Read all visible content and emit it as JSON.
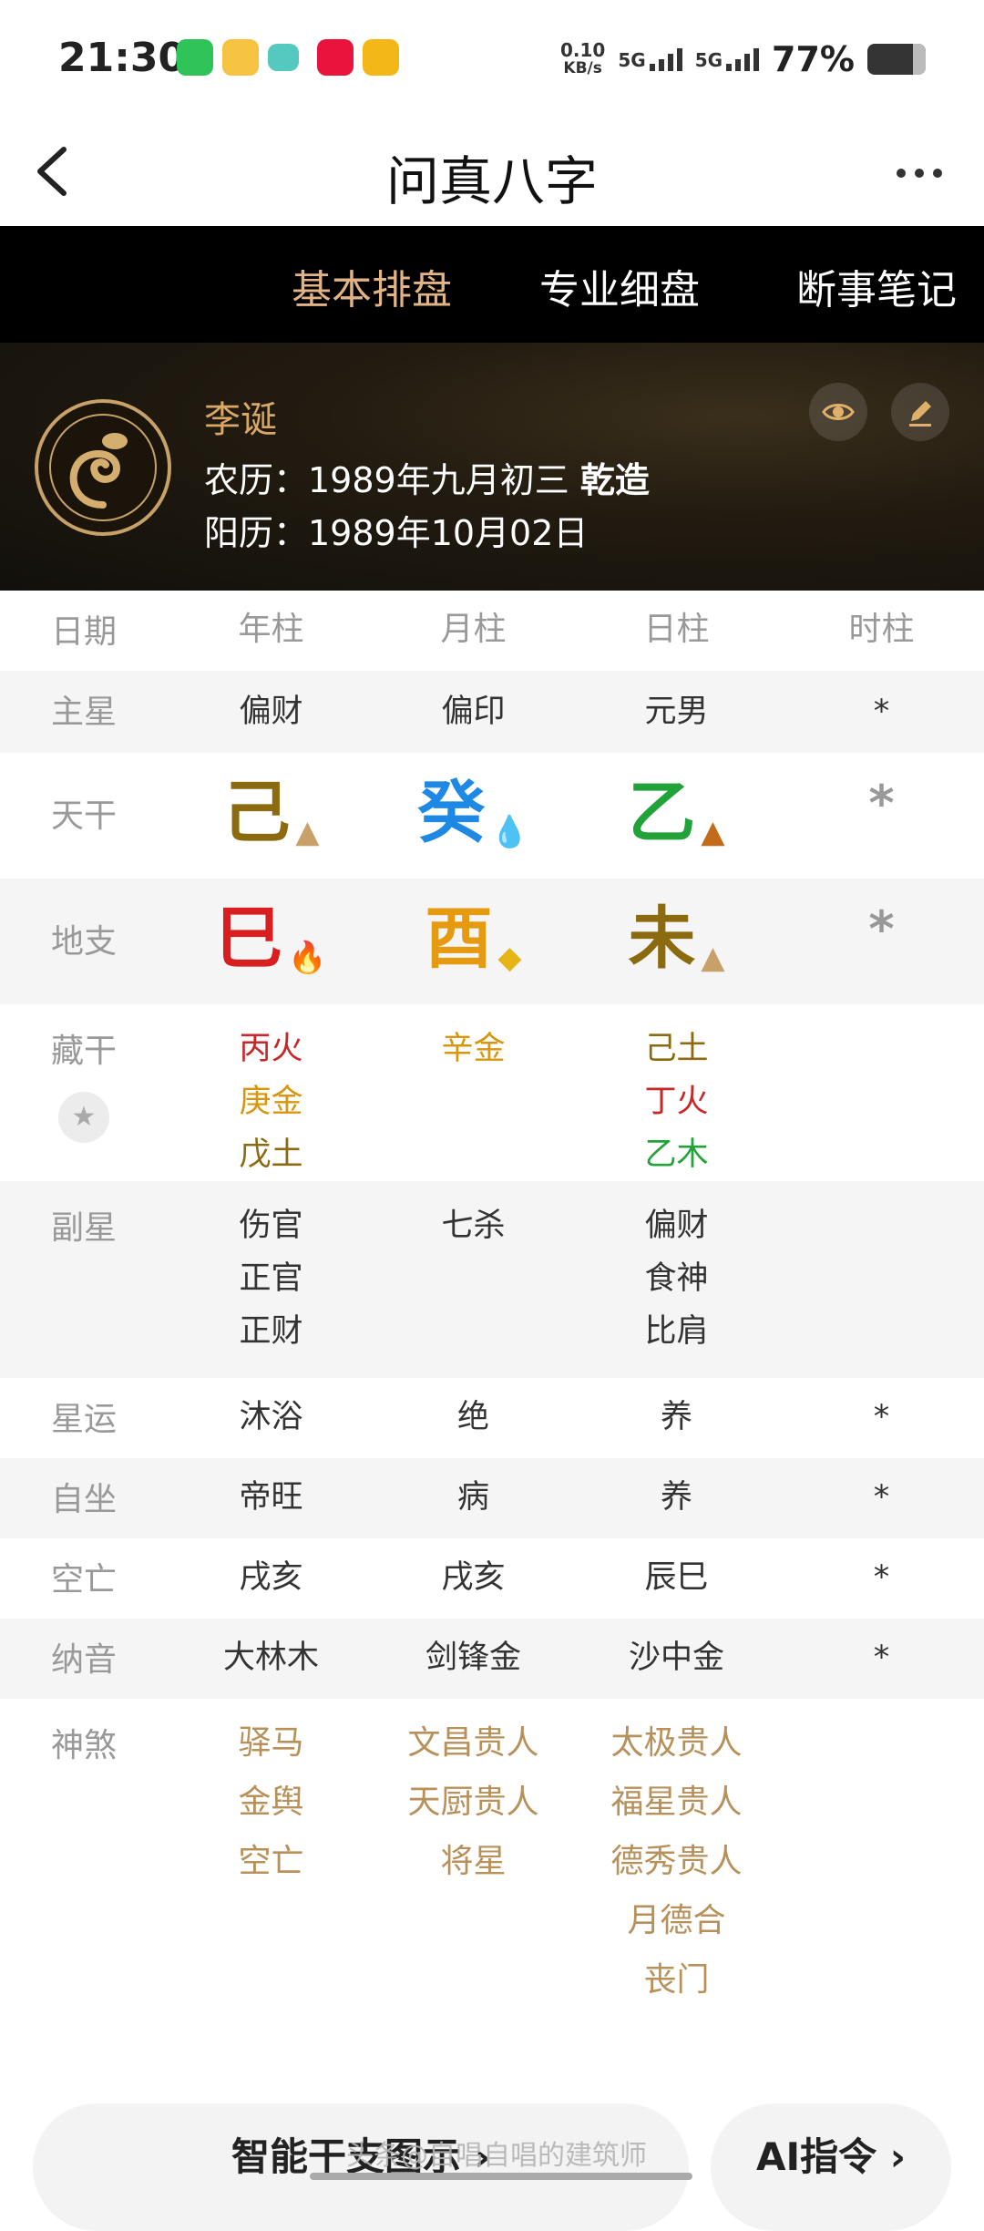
{
  "status_bar": {
    "time": "21:30",
    "speed_value": "0.10",
    "speed_unit": "KB/s",
    "sim1": "5G",
    "sim2": "5G",
    "battery": "77%"
  },
  "nav": {
    "title": "问真八字",
    "back_icon": "chevron-left-icon",
    "more_icon": "more-horizontal-icon"
  },
  "tabs": [
    {
      "label": "基本排盘",
      "active": true
    },
    {
      "label": "专业细盘",
      "active": false
    },
    {
      "label": "断事笔记",
      "active": false
    }
  ],
  "profile": {
    "name": "李诞",
    "lunar_prefix": "农历：1989年九月初三",
    "lunar_suffix": "乾造",
    "solar": "阳历：1989年10月02日"
  },
  "table": {
    "headers": [
      "日期",
      "年柱",
      "月柱",
      "日柱",
      "时柱"
    ],
    "main_star": {
      "label": "主星",
      "values": [
        "偏财",
        "偏印",
        "元男",
        "*"
      ]
    },
    "tiangan": {
      "label": "天干",
      "values": [
        "己",
        "癸",
        "乙",
        "*"
      ],
      "colors": [
        "#8b6a10",
        "#1e88e5",
        "#22a33a",
        "#999999"
      ]
    },
    "dizhi": {
      "label": "地支",
      "values": [
        "巳",
        "酉",
        "未",
        "*"
      ],
      "colors": [
        "#d81e1e",
        "#e69a10",
        "#8b6a10",
        "#999999"
      ]
    },
    "canggan": {
      "label": "藏干",
      "col1": [
        {
          "t": "丙火",
          "c": "#c62828"
        },
        {
          "t": "庚金",
          "c": "#d8960e"
        },
        {
          "t": "戊土",
          "c": "#8b6a10"
        }
      ],
      "col2": [
        {
          "t": "辛金",
          "c": "#d8960e"
        }
      ],
      "col3": [
        {
          "t": "己土",
          "c": "#8b6a10"
        },
        {
          "t": "丁火",
          "c": "#c62828"
        },
        {
          "t": "乙木",
          "c": "#22a33a"
        }
      ]
    },
    "fuxing": {
      "label": "副星",
      "col1": [
        "伤官",
        "正官",
        "正财"
      ],
      "col2": [
        "七杀"
      ],
      "col3": [
        "偏财",
        "食神",
        "比肩"
      ]
    },
    "xingyun": {
      "label": "星运",
      "values": [
        "沐浴",
        "绝",
        "养",
        "*"
      ]
    },
    "zizuo": {
      "label": "自坐",
      "values": [
        "帝旺",
        "病",
        "养",
        "*"
      ]
    },
    "kongwang": {
      "label": "空亡",
      "values": [
        "戌亥",
        "戌亥",
        "辰巳",
        "*"
      ]
    },
    "nayin": {
      "label": "纳音",
      "values": [
        "大林木",
        "剑锋金",
        "沙中金",
        "*"
      ]
    },
    "shensha": {
      "label": "神煞",
      "col1": [
        "驿马",
        "金舆",
        "空亡"
      ],
      "col2": [
        "文昌贵人",
        "天厨贵人",
        "将星"
      ],
      "col3": [
        "太极贵人",
        "福星贵人",
        "德秀贵人",
        "月德合",
        "丧门"
      ]
    }
  },
  "bottom": {
    "btn1": "智能干支图示 ›",
    "btn2": "AI指令 ›",
    "watermark": "头条@自唱自唱的建筑师"
  }
}
